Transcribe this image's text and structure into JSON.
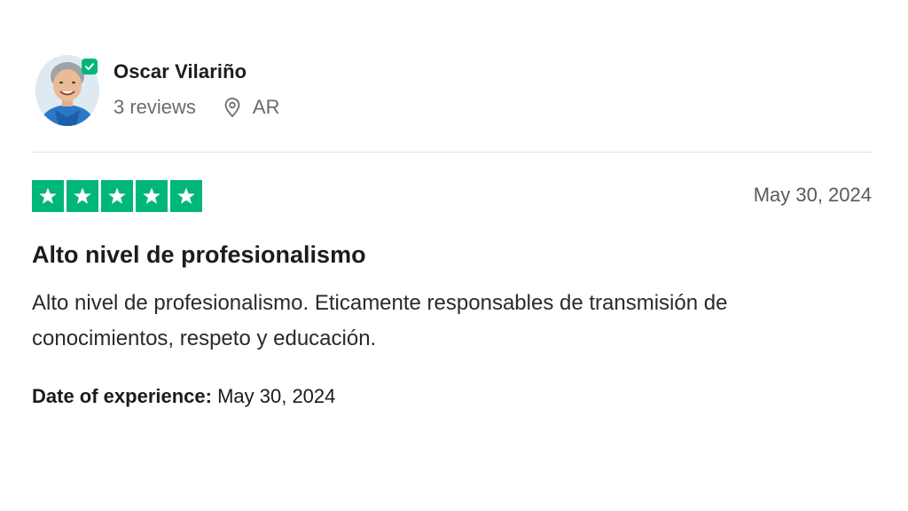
{
  "reviewer": {
    "name": "Oscar Vilariño",
    "reviews_count": "3 reviews",
    "location": "AR",
    "verified": true
  },
  "review": {
    "rating": 5,
    "rating_max": 5,
    "date": "May 30, 2024",
    "title": "Alto nivel de profesionalismo",
    "body": "Alto nivel de profesionalismo. Eticamente responsables de transmisión de conocimientos, respeto y educación.",
    "experience_label": "Date of experience:",
    "experience_date": "May 30, 2024"
  },
  "icons": {
    "verified": "check-badge-icon",
    "location": "map-pin-icon",
    "star": "star-icon"
  },
  "colors": {
    "star_green": "#00b67a",
    "badge_green": "#00b67a",
    "muted_text": "#6b6b6b"
  }
}
